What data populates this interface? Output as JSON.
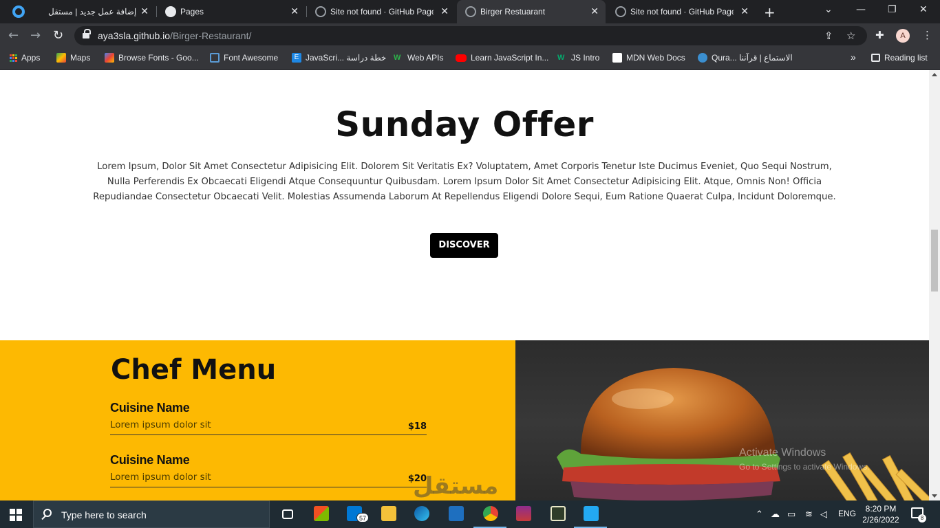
{
  "browser": {
    "tabs": [
      {
        "title": "إضافة عمل جديد | مستقل",
        "active": false
      },
      {
        "title": "Pages",
        "active": false
      },
      {
        "title": "Site not found · GitHub Pages",
        "active": false
      },
      {
        "title": "Birger Restuarant",
        "active": true
      },
      {
        "title": "Site not found · GitHub Pages",
        "active": false
      }
    ],
    "new_tab_glyph": "+",
    "close_glyph": "✕",
    "url_host": "aya3sla.github.io",
    "url_path": "/Birger-Restaurant/",
    "profile_initial": "A",
    "bookmarks": [
      {
        "label": "Apps",
        "icon": "apps-grid-icon"
      },
      {
        "label": "Maps",
        "icon": "maps-icon"
      },
      {
        "label": "Browse Fonts - Goo...",
        "icon": "google-fonts-icon"
      },
      {
        "label": "Font Awesome",
        "icon": "flag-icon"
      },
      {
        "label": "JavaScri... خطة دراسة",
        "icon": "e-icon"
      },
      {
        "label": "Web APIs",
        "icon": "w-icon"
      },
      {
        "label": "Learn JavaScript In...",
        "icon": "youtube-icon"
      },
      {
        "label": "JS Intro",
        "icon": "w3-icon"
      },
      {
        "label": "MDN Web Docs",
        "icon": "mdn-icon"
      },
      {
        "label": "Qura... الاستماع | قرآننا",
        "icon": "quran-icon"
      }
    ],
    "bookmarks_overflow": "»",
    "reading_list": "Reading list"
  },
  "page": {
    "offer": {
      "title": "Sunday Offer",
      "text": "Lorem Ipsum, Dolor Sit Amet Consectetur Adipisicing Elit. Dolorem Sit Veritatis Ex? Voluptatem, Amet Corporis Tenetur Iste Ducimus Eveniet, Quo Sequi Nostrum, Nulla Perferendis Ex Obcaecati Eligendi Atque Consequuntur Quibusdam. Lorem Ipsum Dolor Sit Amet Consectetur Adipisicing Elit. Atque, Omnis Non! Officia Repudiandae Consectetur Obcaecati Velit. Molestias Assumenda Laborum At Repellendus Eligendi Dolore Sequi, Eum Ratione Quaerat Culpa, Incidunt Doloremque.",
      "button": "DISCOVER"
    },
    "chef_menu": {
      "title": "Chef Menu",
      "items": [
        {
          "name": "Cuisine Name",
          "desc": "Lorem ipsum dolor sit",
          "price": "$18"
        },
        {
          "name": "Cuisine Name",
          "desc": "Lorem ipsum dolor sit",
          "price": "$20"
        }
      ]
    },
    "activation": {
      "line1": "Activate Windows",
      "line2": "Go to Settings to activate Windows."
    },
    "watermark": "مستقل"
  },
  "taskbar": {
    "search_placeholder": "Type here to search",
    "mail_badge": "57",
    "language": "ENG",
    "time": "8:20 PM",
    "date": "2/26/2022",
    "notification_count": "8"
  },
  "colors": {
    "chef_bg": "#fdb902",
    "button_bg": "#000000",
    "chrome_dark": "#202124",
    "taskbar": "#1f2b33"
  }
}
